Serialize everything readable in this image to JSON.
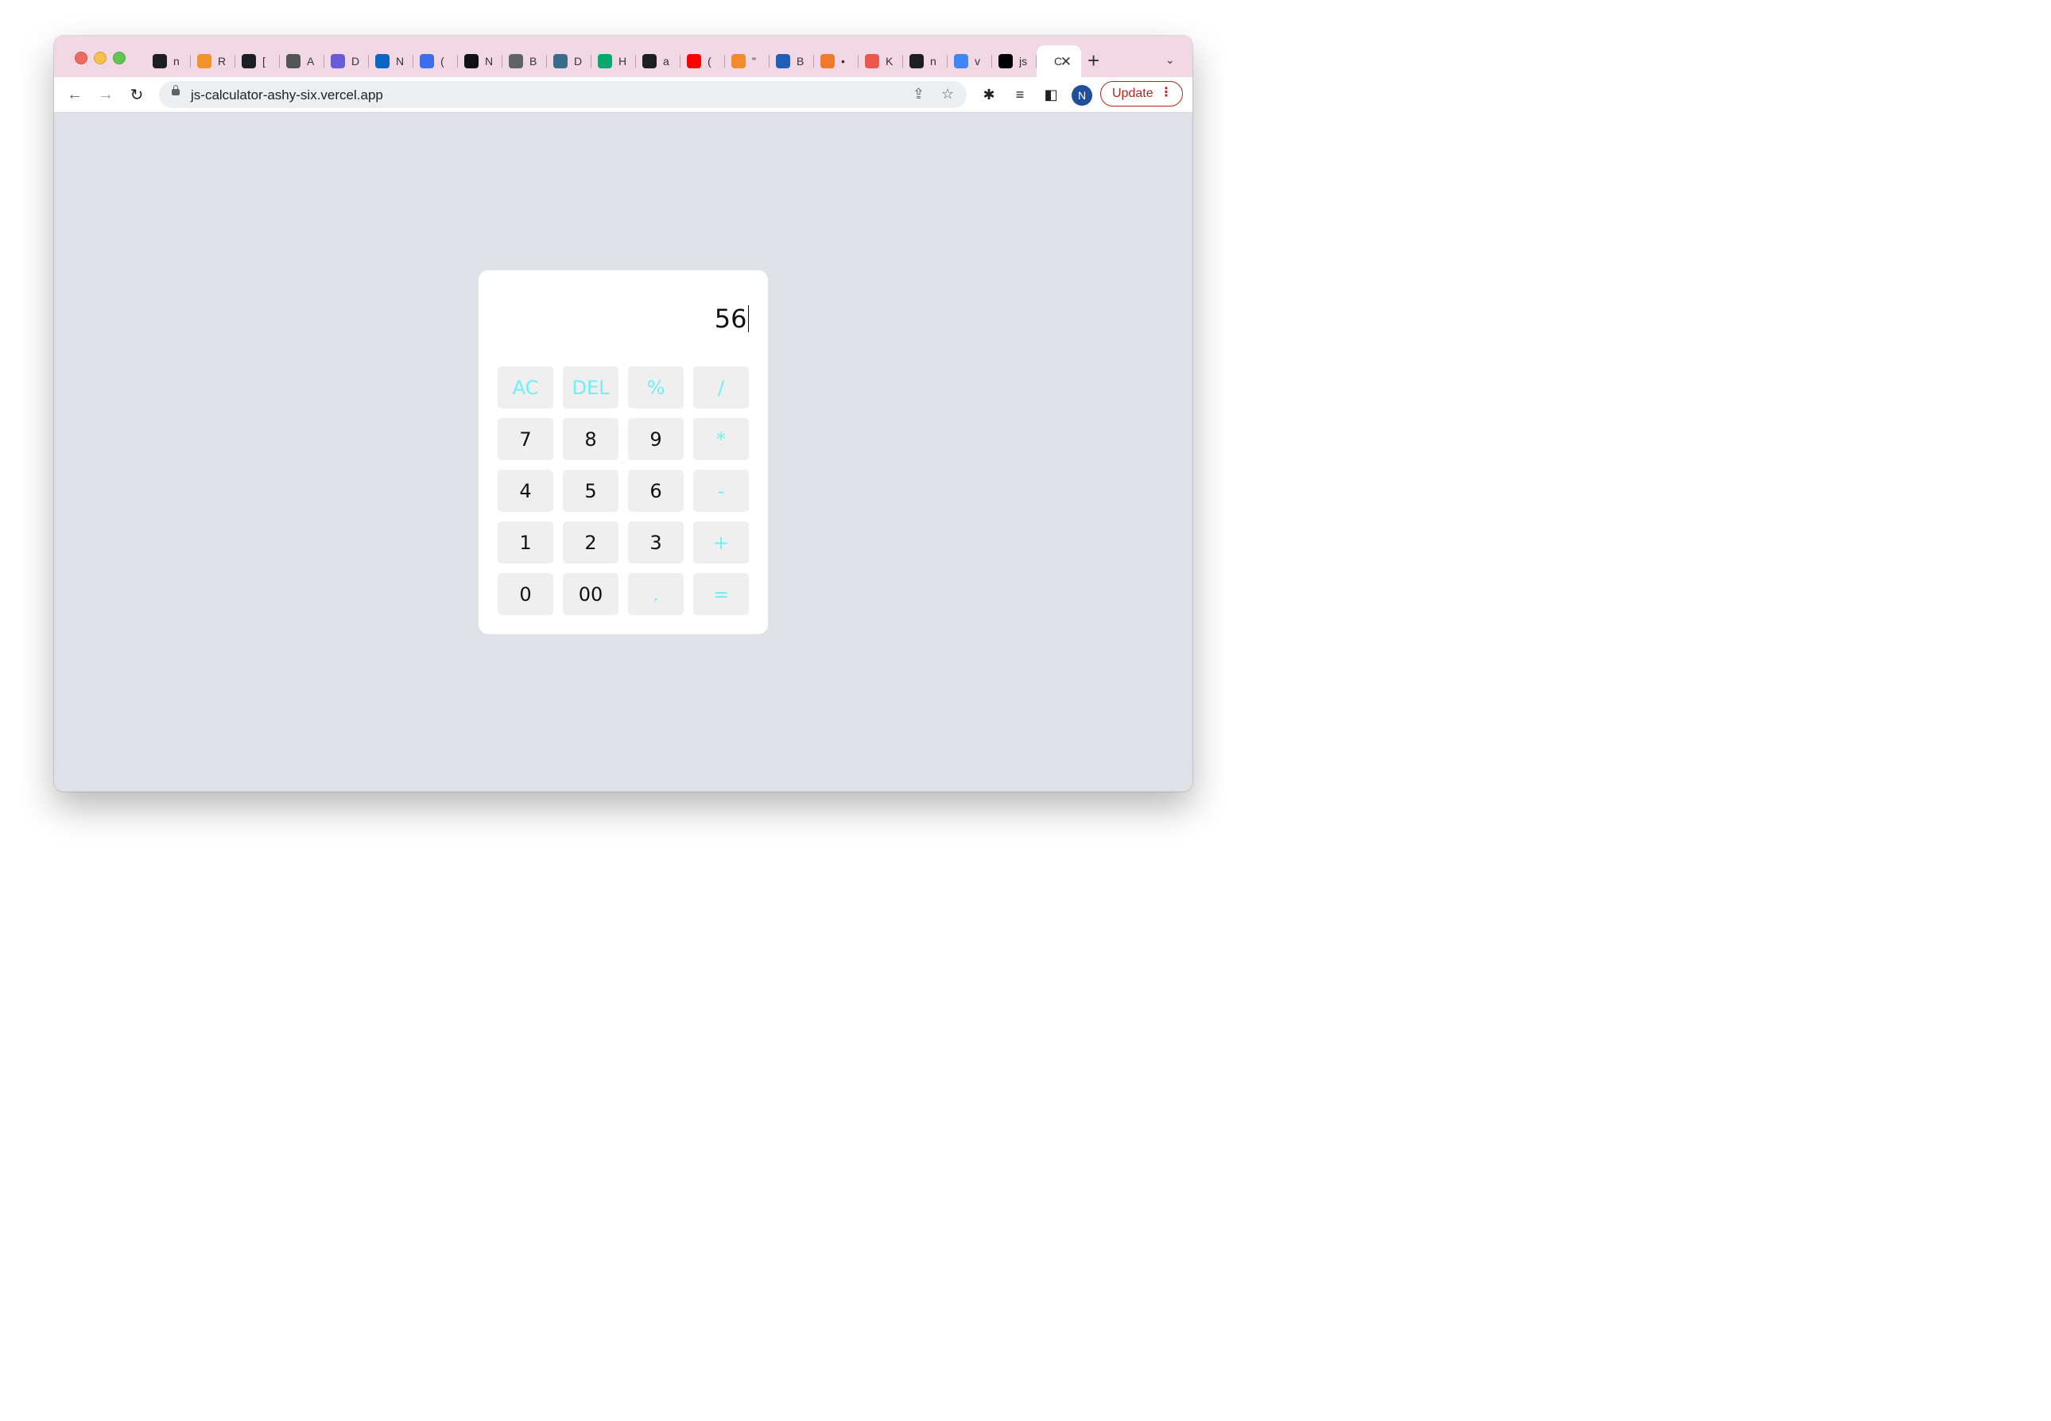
{
  "browser": {
    "tabs": [
      {
        "icon": "github-icon",
        "title": "n",
        "color": "#1b1f23"
      },
      {
        "icon": "grammarly-icon",
        "title": "R",
        "color": "#f0932b"
      },
      {
        "icon": "github-icon",
        "title": "[",
        "color": "#1b1f23"
      },
      {
        "icon": "car-icon",
        "title": "A",
        "color": "#555555"
      },
      {
        "icon": "card-icon",
        "title": "D",
        "color": "#6b5bd6"
      },
      {
        "icon": "linkedin-icon",
        "title": "N",
        "color": "#0a66c2"
      },
      {
        "icon": "badge-icon",
        "title": "(",
        "color": "#3d6ef0"
      },
      {
        "icon": "bold-b-icon",
        "title": "N",
        "color": "#111111"
      },
      {
        "icon": "globe-icon",
        "title": "B",
        "color": "#5f6368"
      },
      {
        "icon": "bucket-icon",
        "title": "D",
        "color": "#3a6d8c"
      },
      {
        "icon": "w3-icon",
        "title": "H",
        "color": "#04aa6d"
      },
      {
        "icon": "github-icon",
        "title": "a",
        "color": "#1b1f23"
      },
      {
        "icon": "youtube-icon",
        "title": "(",
        "color": "#ff0000"
      },
      {
        "icon": "two-icon",
        "title": "\"",
        "color": "#f08c2b"
      },
      {
        "icon": "bracket-icon",
        "title": "B",
        "color": "#1f5fb8"
      },
      {
        "icon": "arrow-icon",
        "title": "•",
        "color": "#f07a2b"
      },
      {
        "icon": "knot-icon",
        "title": "K",
        "color": "#e8584d"
      },
      {
        "icon": "github-icon",
        "title": "n",
        "color": "#1b1f23"
      },
      {
        "icon": "google-icon",
        "title": "v",
        "color": "#4285f4"
      },
      {
        "icon": "vercel-icon",
        "title": "js",
        "color": "#000000"
      }
    ],
    "active_tab": {
      "title": "C",
      "close": "✕"
    },
    "new_tab": "+",
    "tab_menu": "⌄",
    "back": "←",
    "forward": "→",
    "reload": "↻",
    "url": "js-calculator-ashy-six.vercel.app",
    "share": "⇪",
    "star": "☆",
    "extensions": "✱",
    "media": "≡",
    "sidepanel": "◧",
    "avatar": "N",
    "update_label": "Update",
    "update_menu": "⋮"
  },
  "calculator": {
    "display": "56",
    "keys": [
      {
        "label": "AC",
        "type": "op",
        "name": "all-clear-button"
      },
      {
        "label": "DEL",
        "type": "op",
        "name": "delete-button"
      },
      {
        "label": "%",
        "type": "op",
        "name": "percent-button"
      },
      {
        "label": "/",
        "type": "op",
        "name": "divide-button"
      },
      {
        "label": "7",
        "type": "num",
        "name": "digit-7-button"
      },
      {
        "label": "8",
        "type": "num",
        "name": "digit-8-button"
      },
      {
        "label": "9",
        "type": "num",
        "name": "digit-9-button"
      },
      {
        "label": "*",
        "type": "op",
        "name": "multiply-button"
      },
      {
        "label": "4",
        "type": "num",
        "name": "digit-4-button"
      },
      {
        "label": "5",
        "type": "num",
        "name": "digit-5-button"
      },
      {
        "label": "6",
        "type": "num",
        "name": "digit-6-button"
      },
      {
        "label": "-",
        "type": "op",
        "name": "subtract-button"
      },
      {
        "label": "1",
        "type": "num",
        "name": "digit-1-button"
      },
      {
        "label": "2",
        "type": "num",
        "name": "digit-2-button"
      },
      {
        "label": "3",
        "type": "num",
        "name": "digit-3-button"
      },
      {
        "label": "+",
        "type": "op",
        "name": "add-button"
      },
      {
        "label": "0",
        "type": "num",
        "name": "digit-0-button"
      },
      {
        "label": "00",
        "type": "num",
        "name": "double-zero-button"
      },
      {
        "label": ".",
        "type": "op",
        "name": "decimal-button"
      },
      {
        "label": "=",
        "type": "op",
        "name": "equals-button"
      }
    ],
    "operator_color": "#6ef0f5",
    "background_color": "#dfe1e8"
  }
}
